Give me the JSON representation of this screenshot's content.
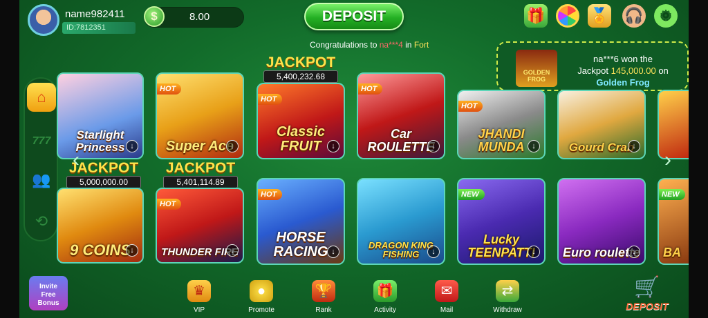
{
  "user": {
    "name": "name982411",
    "id": "ID:7812351",
    "currency_symbol": "$",
    "balance": "8.00"
  },
  "header": {
    "deposit_label": "DEPOSIT",
    "icons": [
      "gift-icon",
      "lucky-wheel-icon",
      "reward-icon",
      "support-icon",
      "settings-icon"
    ]
  },
  "marquee": {
    "prefix": "Congratulations to",
    "name": "na***4",
    "mid": "in",
    "game": "Fort"
  },
  "toast": {
    "game_image_label": "GOLDEN FROG",
    "line1": "na***6 won the",
    "line2_prefix": "Jackpot",
    "amount": "145,000.00",
    "line2_suffix": "on",
    "game": "Golden Frog"
  },
  "sidebar": {
    "items": [
      {
        "name": "home",
        "icon": "home-icon"
      },
      {
        "name": "slots",
        "label": "777"
      },
      {
        "name": "friends",
        "icon": "people-icon"
      },
      {
        "name": "history",
        "icon": "history-icon"
      }
    ]
  },
  "games": {
    "row1": [
      {
        "title": "Starlight Princess",
        "badge": ""
      },
      {
        "title": "Super Ace",
        "badge": "HOT"
      },
      {
        "title": "Classic FRUIT",
        "badge": "HOT",
        "jackpot_label": "JACKPOT",
        "jackpot_value": "5,400,232.68"
      },
      {
        "title": "Car ROULETTE",
        "badge": "HOT"
      },
      {
        "title": "JHANDI MUNDA",
        "badge": "HOT"
      },
      {
        "title": "Gourd Crab",
        "badge": ""
      }
    ],
    "row2": [
      {
        "title": "9 COINS",
        "badge": "",
        "jackpot_label": "JACKPOT",
        "jackpot_value": "5,000,000.00"
      },
      {
        "title": "THUNDER FIRE",
        "badge": "HOT",
        "jackpot_label": "JACKPOT",
        "jackpot_value": "5,401,114.89"
      },
      {
        "title": "HORSE RACING",
        "badge": "HOT"
      },
      {
        "title": "DRAGON KING FISHING",
        "badge": ""
      },
      {
        "title": "Lucky TEENPATTI",
        "badge": "NEW"
      },
      {
        "title": "Euro roulette",
        "badge": ""
      },
      {
        "title": "BA",
        "badge": "NEW"
      }
    ]
  },
  "promo": {
    "line1": "Invite",
    "line2": "Free",
    "line3": "Bonus"
  },
  "bottom_nav": [
    {
      "label": "VIP",
      "icon": "vip-crown-icon"
    },
    {
      "label": "Promote",
      "icon": "coins-icon"
    },
    {
      "label": "Rank",
      "icon": "trophy-icon"
    },
    {
      "label": "Activity",
      "icon": "gift-box-icon"
    },
    {
      "label": "Mail",
      "icon": "mailbox-icon"
    },
    {
      "label": "Withdraw",
      "icon": "withdraw-icon"
    }
  ],
  "bottom_deposit_label": "DEPOSIT",
  "colors": {
    "background": "#126b2a",
    "accent_green": "#24b024",
    "jackpot_gold": "#ffe24a",
    "highlight_red": "#ff6a6a"
  }
}
